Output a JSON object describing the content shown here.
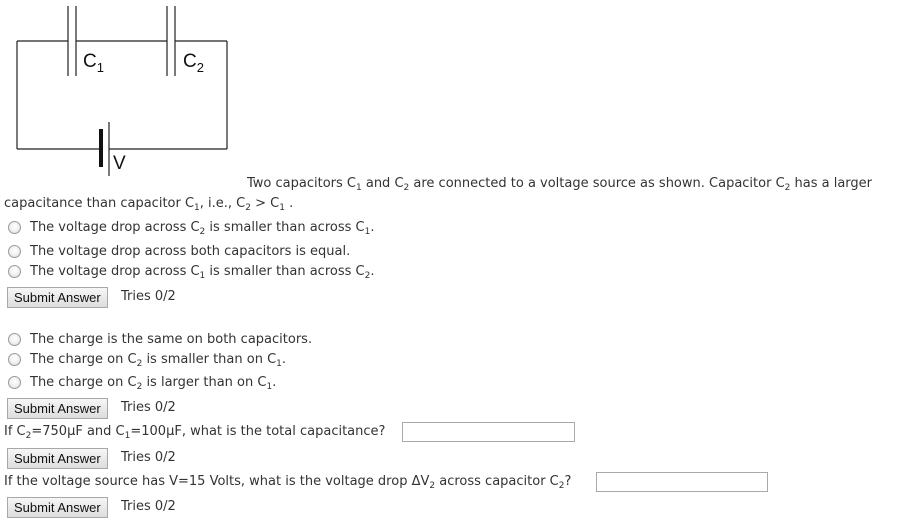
{
  "circuit": {
    "c1_symbol": "C",
    "c1_sub": "1",
    "c2_symbol": "C",
    "c2_sub": "2",
    "v_label": "V"
  },
  "intro": {
    "line1_a": "Two capacitors C",
    "line1_b": "1",
    "line1_c": " and C",
    "line1_d": "2",
    "line1_e": " are connected to a voltage source as shown. Capacitor C",
    "line1_f": "2",
    "line1_g": " has a larger",
    "line2_a": "capacitance than capacitor C",
    "line2_b": "1",
    "line2_c": ", i.e., C",
    "line2_d": "2",
    "line2_e": " > C",
    "line2_f": "1",
    "line2_g": " ."
  },
  "q1": {
    "options": [
      {
        "a": "The voltage drop across C",
        "b": "2",
        "c": " is smaller than across C",
        "d": "1",
        "e": "."
      },
      {
        "a": "The voltage drop across both capacitors is equal."
      },
      {
        "a": "The voltage drop across C",
        "b": "1",
        "c": " is smaller than across C",
        "d": "2",
        "e": "."
      }
    ],
    "submit_label": "Submit Answer",
    "tries": "Tries 0/2"
  },
  "q2": {
    "options": [
      {
        "a": "The charge is the same on both capacitors."
      },
      {
        "a": "The charge on C",
        "b": "2",
        "c": " is smaller than on C",
        "d": "1",
        "e": "."
      },
      {
        "a": "The charge on C",
        "b": "2",
        "c": " is larger than on C",
        "d": "1",
        "e": "."
      }
    ],
    "submit_label": "Submit Answer",
    "tries": "Tries 0/2"
  },
  "q3": {
    "a": "If C",
    "b": "2",
    "c": "=750μF and C",
    "d": "1",
    "e": "=100μF, what is the total capacitance?",
    "input_value": "",
    "submit_label": "Submit Answer",
    "tries": "Tries 0/2"
  },
  "q4": {
    "a": "If the voltage source has V=15 Volts, what is the voltage drop ΔV",
    "b": "2",
    "c": " across capacitor C",
    "d": "2",
    "e": "?",
    "input_value": "",
    "submit_label": "Submit Answer",
    "tries": "Tries 0/2"
  }
}
